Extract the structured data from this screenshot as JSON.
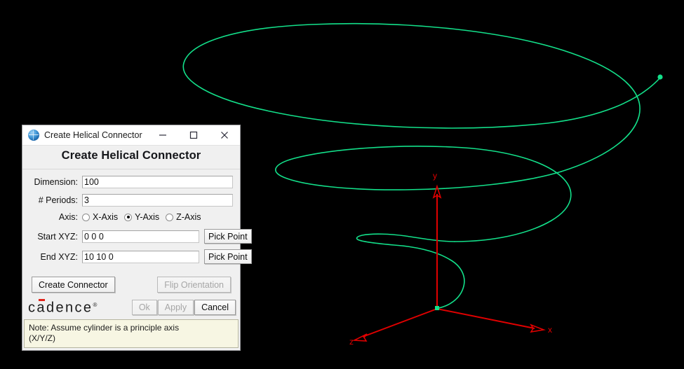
{
  "window": {
    "title": "Create Helical Connector",
    "icon": "globe-icon",
    "minimize_label": "–",
    "maximize_label": "□",
    "close_label": "✕"
  },
  "dialog": {
    "heading": "Create Helical Connector",
    "fields": [
      {
        "label": "Dimension:",
        "value": "100",
        "pick_label": null
      },
      {
        "label": "# Periods:",
        "value": "3",
        "pick_label": null
      }
    ],
    "axis": {
      "label": "Axis:",
      "options": [
        {
          "label": "X-Axis",
          "selected": false
        },
        {
          "label": "Y-Axis",
          "selected": true
        },
        {
          "label": "Z-Axis",
          "selected": false
        }
      ]
    },
    "coords": [
      {
        "label": "Start XYZ:",
        "value": "0 0 0",
        "pick_label": "Pick Point"
      },
      {
        "label": "End XYZ:",
        "value": "10 10 0",
        "pick_label": "Pick Point"
      }
    ],
    "actions": {
      "create_label": "Create Connector",
      "flip_label": "Flip Orientation",
      "flip_disabled": true
    },
    "brand": {
      "name_before": "c",
      "name_a": "a",
      "name_after": "dence",
      "registered": "®"
    },
    "footer_buttons": [
      {
        "label": "Ok",
        "disabled": true
      },
      {
        "label": "Apply",
        "disabled": true
      },
      {
        "label": "Cancel",
        "disabled": false
      }
    ],
    "note": "Note: Assume cylinder is a principle axis\n(X/Y/Z)"
  },
  "viewport": {
    "background": "#000000",
    "curve_color": "#13e08a",
    "axis_color": "#e00000",
    "axes": [
      {
        "name": "x-axis",
        "label": "x"
      },
      {
        "name": "y-axis",
        "label": "y"
      },
      {
        "name": "z-axis",
        "label": "z"
      }
    ],
    "origin_marker": "origin-point",
    "end_marker": "helix-end-point",
    "geometry_name": "helical-connector-curve"
  }
}
